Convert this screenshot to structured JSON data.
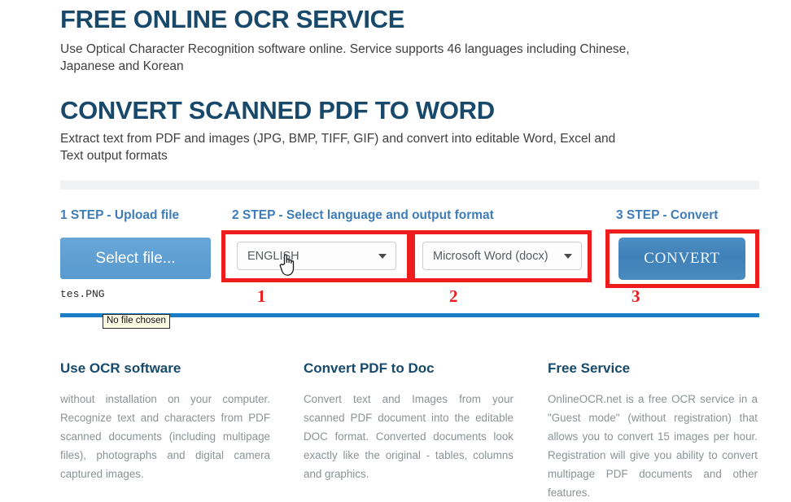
{
  "hero": {
    "title_1": "FREE ONLINE OCR SERVICE",
    "subtitle_1": "Use Optical Character Recognition software online. Service supports 46 languages including Chinese, Japanese and Korean",
    "title_2": "CONVERT SCANNED PDF TO WORD",
    "subtitle_2": "Extract text from PDF and images (JPG, BMP, TIFF, GIF) and convert into editable Word, Excel and Text output formats"
  },
  "steps": {
    "step_1_label": "1 STEP - Upload file",
    "step_2_label": "2 STEP - Select language and output format",
    "step_3_label": "3 STEP - Convert"
  },
  "upload": {
    "select_file_label": "Select file...",
    "file_name": "tes.PNG",
    "tooltip": "No file chosen"
  },
  "language_select": {
    "value": "ENGLISH",
    "arrow_icon": "chevron-down-icon"
  },
  "format_select": {
    "value": "Microsoft Word (docx)",
    "arrow_icon": "chevron-down-icon"
  },
  "convert": {
    "label": "CONVERT"
  },
  "annotations": {
    "marker_1": "1",
    "marker_2": "2",
    "marker_3": "3",
    "color": "#ee1c1c"
  },
  "cursor": {
    "icon": "pointing-hand-cursor"
  },
  "info_columns": [
    {
      "heading": "Use OCR software",
      "body": "without installation on your computer. Recognize text and characters from PDF scanned documents (including multipage files), photographs and digital camera captured images."
    },
    {
      "heading": "Convert PDF to Doc",
      "body": "Convert text and Images from your scanned PDF document into the editable DOC format. Converted documents look exactly like the original - tables, columns and graphics."
    },
    {
      "heading": "Free Service",
      "body": "OnlineOCR.net is a free OCR service in a \"Guest mode\" (without registration) that allows you to convert 15 images per hour. Registration will give you ability to convert multipage PDF documents and other features."
    }
  ],
  "theme": {
    "heading_navy": "#17496b",
    "step_blue": "#3d7cb8",
    "rule_blue": "#1c7cc4",
    "button_blue": "#5a9bcf",
    "body_gray": "#8c9296"
  }
}
